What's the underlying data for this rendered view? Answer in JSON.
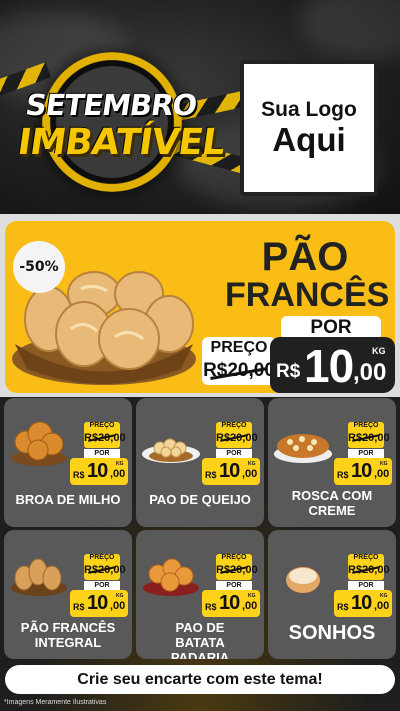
{
  "header": {
    "badge_line1": "SETEMBRO",
    "badge_line2": "IMBATÍVEL",
    "logo_line1": "Sua Logo",
    "logo_line2": "Aqui"
  },
  "hero": {
    "discount": "-50%",
    "title_line1": "PÃO",
    "title_line2": "FRANCÊS",
    "por": "POR",
    "preco_label": "PREÇO",
    "old_price": "R$20,00",
    "currency": "R$",
    "price_int": "10",
    "price_dec": ",00",
    "unit": "KG"
  },
  "products": [
    {
      "name": "BROA DE MILHO",
      "preco_label": "PREÇO",
      "old_price": "R$20,00",
      "por": "POR",
      "currency": "R$",
      "price_int": "10",
      "price_dec": ",00",
      "unit": "KG",
      "icon": "broa-icon"
    },
    {
      "name": "PAO DE QUEIJO",
      "preco_label": "PREÇO",
      "old_price": "R$20,00",
      "por": "POR",
      "currency": "R$",
      "price_int": "10",
      "price_dec": ",00",
      "unit": "KG",
      "icon": "pao-de-queijo-icon"
    },
    {
      "name": "ROSCA COM CREME",
      "preco_label": "PREÇO",
      "old_price": "R$20,00",
      "por": "POR",
      "currency": "R$",
      "price_int": "10",
      "price_dec": ",00",
      "unit": "KG",
      "icon": "rosca-icon"
    },
    {
      "name": "PÃO FRANCÊS INTEGRAL",
      "preco_label": "PREÇO",
      "old_price": "R$20,00",
      "por": "POR",
      "currency": "R$",
      "price_int": "10",
      "price_dec": ",00",
      "unit": "KG",
      "icon": "pao-integral-icon"
    },
    {
      "name": "PAO DE BATATA PADARIA",
      "preco_label": "PREÇO",
      "old_price": "R$20,00",
      "por": "POR",
      "currency": "R$",
      "price_int": "10",
      "price_dec": ",00",
      "unit": "KG",
      "icon": "pao-batata-icon"
    },
    {
      "name": "SONHOS",
      "preco_label": "PREÇO",
      "old_price": "R$20,00",
      "por": "POR",
      "currency": "R$",
      "price_int": "10",
      "price_dec": ",00",
      "unit": "KG",
      "icon": "sonho-icon"
    }
  ],
  "cta": "Crie seu encarte com este tema!",
  "footnote": "*Imagens Meramente Ilustrativas",
  "colors": {
    "accent": "#f9bd16",
    "card": "#595959",
    "dark": "#202020"
  }
}
